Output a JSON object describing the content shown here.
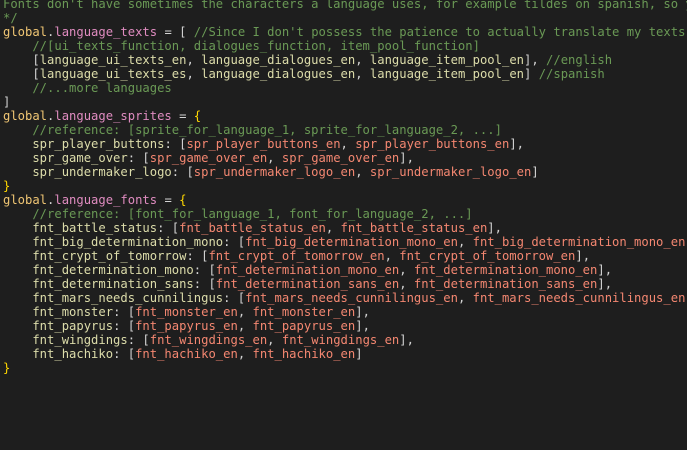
{
  "colors": {
    "background": "#1e1e1e",
    "comment": "#6a9955",
    "identifier": "#dcdcaa",
    "property": "#ce9178",
    "value": "#f48771",
    "brace": "#ffd700"
  },
  "lines": [
    [
      {
        "c": "t-comment",
        "t": "Fonts don't have sometimes the characters a language uses, for example tildes on spanish, so you could"
      }
    ],
    [
      {
        "c": "t-comment",
        "t": "*/"
      }
    ],
    [
      {
        "c": "t-global",
        "t": "global"
      },
      {
        "c": "t-dot",
        "t": "."
      },
      {
        "c": "t-pink",
        "t": "language_texts"
      },
      {
        "c": "t-plain",
        "t": " = [ "
      },
      {
        "c": "t-comment",
        "t": "//Since I don't possess the patience to actually translate my texts to span"
      }
    ],
    [
      {
        "c": "t-comment",
        "t": "    //[ui_texts_function, dialogues_function, item_pool_function]"
      }
    ],
    [
      {
        "c": "t-plain",
        "t": "    ["
      },
      {
        "c": "t-langval",
        "t": "language_ui_texts_en"
      },
      {
        "c": "t-plain",
        "t": ", "
      },
      {
        "c": "t-langval",
        "t": "language_dialogues_en"
      },
      {
        "c": "t-plain",
        "t": ", "
      },
      {
        "c": "t-langval",
        "t": "language_item_pool_en"
      },
      {
        "c": "t-plain",
        "t": "], "
      },
      {
        "c": "t-comment",
        "t": "//english"
      }
    ],
    [
      {
        "c": "t-plain",
        "t": "    ["
      },
      {
        "c": "t-langval",
        "t": "language_ui_texts_es"
      },
      {
        "c": "t-plain",
        "t": ", "
      },
      {
        "c": "t-langval",
        "t": "language_dialogues_en"
      },
      {
        "c": "t-plain",
        "t": ", "
      },
      {
        "c": "t-langval",
        "t": "language_item_pool_en"
      },
      {
        "c": "t-plain",
        "t": "] "
      },
      {
        "c": "t-comment",
        "t": "//spanish"
      }
    ],
    [
      {
        "c": "t-comment",
        "t": "    //...more languages"
      }
    ],
    [
      {
        "c": "t-plain",
        "t": "]"
      }
    ],
    [
      {
        "c": "t-global",
        "t": "global"
      },
      {
        "c": "t-dot",
        "t": "."
      },
      {
        "c": "t-pink",
        "t": "language_sprites"
      },
      {
        "c": "t-plain",
        "t": " = "
      },
      {
        "c": "t-brace",
        "t": "{"
      }
    ],
    [
      {
        "c": "t-comment",
        "t": "    //reference: [sprite_for_language_1, sprite_for_language_2, ...]"
      }
    ],
    [
      {
        "c": "t-langval",
        "t": "    spr_player_buttons"
      },
      {
        "c": "t-plain",
        "t": ": ["
      },
      {
        "c": "t-value",
        "t": "spr_player_buttons_en"
      },
      {
        "c": "t-plain",
        "t": ", "
      },
      {
        "c": "t-value",
        "t": "spr_player_buttons_en"
      },
      {
        "c": "t-plain",
        "t": "],"
      }
    ],
    [
      {
        "c": "t-langval",
        "t": "    spr_game_over"
      },
      {
        "c": "t-plain",
        "t": ": ["
      },
      {
        "c": "t-value",
        "t": "spr_game_over_en"
      },
      {
        "c": "t-plain",
        "t": ", "
      },
      {
        "c": "t-value",
        "t": "spr_game_over_en"
      },
      {
        "c": "t-plain",
        "t": "],"
      }
    ],
    [
      {
        "c": "t-langval",
        "t": "    spr_undermaker_logo"
      },
      {
        "c": "t-plain",
        "t": ": ["
      },
      {
        "c": "t-value",
        "t": "spr_undermaker_logo_en"
      },
      {
        "c": "t-plain",
        "t": ", "
      },
      {
        "c": "t-value",
        "t": "spr_undermaker_logo_en"
      },
      {
        "c": "t-plain",
        "t": "]"
      }
    ],
    [
      {
        "c": "t-brace",
        "t": "}"
      }
    ],
    [
      {
        "c": "t-global",
        "t": "global"
      },
      {
        "c": "t-dot",
        "t": "."
      },
      {
        "c": "t-pink",
        "t": "language_fonts"
      },
      {
        "c": "t-plain",
        "t": " = "
      },
      {
        "c": "t-brace",
        "t": "{"
      }
    ],
    [
      {
        "c": "t-comment",
        "t": "    //reference: [font_for_language_1, font_for_language_2, ...]"
      }
    ],
    [
      {
        "c": "t-langval",
        "t": "    fnt_battle_status"
      },
      {
        "c": "t-plain",
        "t": ": ["
      },
      {
        "c": "t-value",
        "t": "fnt_battle_status_en"
      },
      {
        "c": "t-plain",
        "t": ", "
      },
      {
        "c": "t-value",
        "t": "fnt_battle_status_en"
      },
      {
        "c": "t-plain",
        "t": "],"
      }
    ],
    [
      {
        "c": "t-langval",
        "t": "    fnt_big_determination_mono"
      },
      {
        "c": "t-plain",
        "t": ": ["
      },
      {
        "c": "t-value",
        "t": "fnt_big_determination_mono_en"
      },
      {
        "c": "t-plain",
        "t": ", "
      },
      {
        "c": "t-value",
        "t": "fnt_big_determination_mono_en"
      },
      {
        "c": "t-plain",
        "t": "],"
      }
    ],
    [
      {
        "c": "t-langval",
        "t": "    fnt_crypt_of_tomorrow"
      },
      {
        "c": "t-plain",
        "t": ": ["
      },
      {
        "c": "t-value",
        "t": "fnt_crypt_of_tomorrow_en"
      },
      {
        "c": "t-plain",
        "t": ", "
      },
      {
        "c": "t-value",
        "t": "fnt_crypt_of_tomorrow_en"
      },
      {
        "c": "t-plain",
        "t": "],"
      }
    ],
    [
      {
        "c": "t-langval",
        "t": "    fnt_determination_mono"
      },
      {
        "c": "t-plain",
        "t": ": ["
      },
      {
        "c": "t-value",
        "t": "fnt_determination_mono_en"
      },
      {
        "c": "t-plain",
        "t": ", "
      },
      {
        "c": "t-value",
        "t": "fnt_determination_mono_en"
      },
      {
        "c": "t-plain",
        "t": "],"
      }
    ],
    [
      {
        "c": "t-langval",
        "t": "    fnt_determination_sans"
      },
      {
        "c": "t-plain",
        "t": ": ["
      },
      {
        "c": "t-value",
        "t": "fnt_determination_sans_en"
      },
      {
        "c": "t-plain",
        "t": ", "
      },
      {
        "c": "t-value",
        "t": "fnt_determination_sans_en"
      },
      {
        "c": "t-plain",
        "t": "],"
      }
    ],
    [
      {
        "c": "t-langval",
        "t": "    fnt_mars_needs_cunnilingus"
      },
      {
        "c": "t-plain",
        "t": ": ["
      },
      {
        "c": "t-value",
        "t": "fnt_mars_needs_cunnilingus_en"
      },
      {
        "c": "t-plain",
        "t": ", "
      },
      {
        "c": "t-value",
        "t": "fnt_mars_needs_cunnilingus_en"
      },
      {
        "c": "t-plain",
        "t": "],"
      }
    ],
    [
      {
        "c": "t-langval",
        "t": "    fnt_monster"
      },
      {
        "c": "t-plain",
        "t": ": ["
      },
      {
        "c": "t-value",
        "t": "fnt_monster_en"
      },
      {
        "c": "t-plain",
        "t": ", "
      },
      {
        "c": "t-value",
        "t": "fnt_monster_en"
      },
      {
        "c": "t-plain",
        "t": "],"
      }
    ],
    [
      {
        "c": "t-langval",
        "t": "    fnt_papyrus"
      },
      {
        "c": "t-plain",
        "t": ": ["
      },
      {
        "c": "t-value",
        "t": "fnt_papyrus_en"
      },
      {
        "c": "t-plain",
        "t": ", "
      },
      {
        "c": "t-value",
        "t": "fnt_papyrus_en"
      },
      {
        "c": "t-plain",
        "t": "],"
      }
    ],
    [
      {
        "c": "t-langval",
        "t": "    fnt_wingdings"
      },
      {
        "c": "t-plain",
        "t": ": ["
      },
      {
        "c": "t-value",
        "t": "fnt_wingdings_en"
      },
      {
        "c": "t-plain",
        "t": ", "
      },
      {
        "c": "t-value",
        "t": "fnt_wingdings_en"
      },
      {
        "c": "t-plain",
        "t": "],"
      }
    ],
    [
      {
        "c": "t-langval",
        "t": "    fnt_hachiko"
      },
      {
        "c": "t-plain",
        "t": ": ["
      },
      {
        "c": "t-value",
        "t": "fnt_hachiko_en"
      },
      {
        "c": "t-plain",
        "t": ", "
      },
      {
        "c": "t-value",
        "t": "fnt_hachiko_en"
      },
      {
        "c": "t-plain",
        "t": "]"
      }
    ],
    [
      {
        "c": "t-brace",
        "t": "}"
      }
    ]
  ]
}
